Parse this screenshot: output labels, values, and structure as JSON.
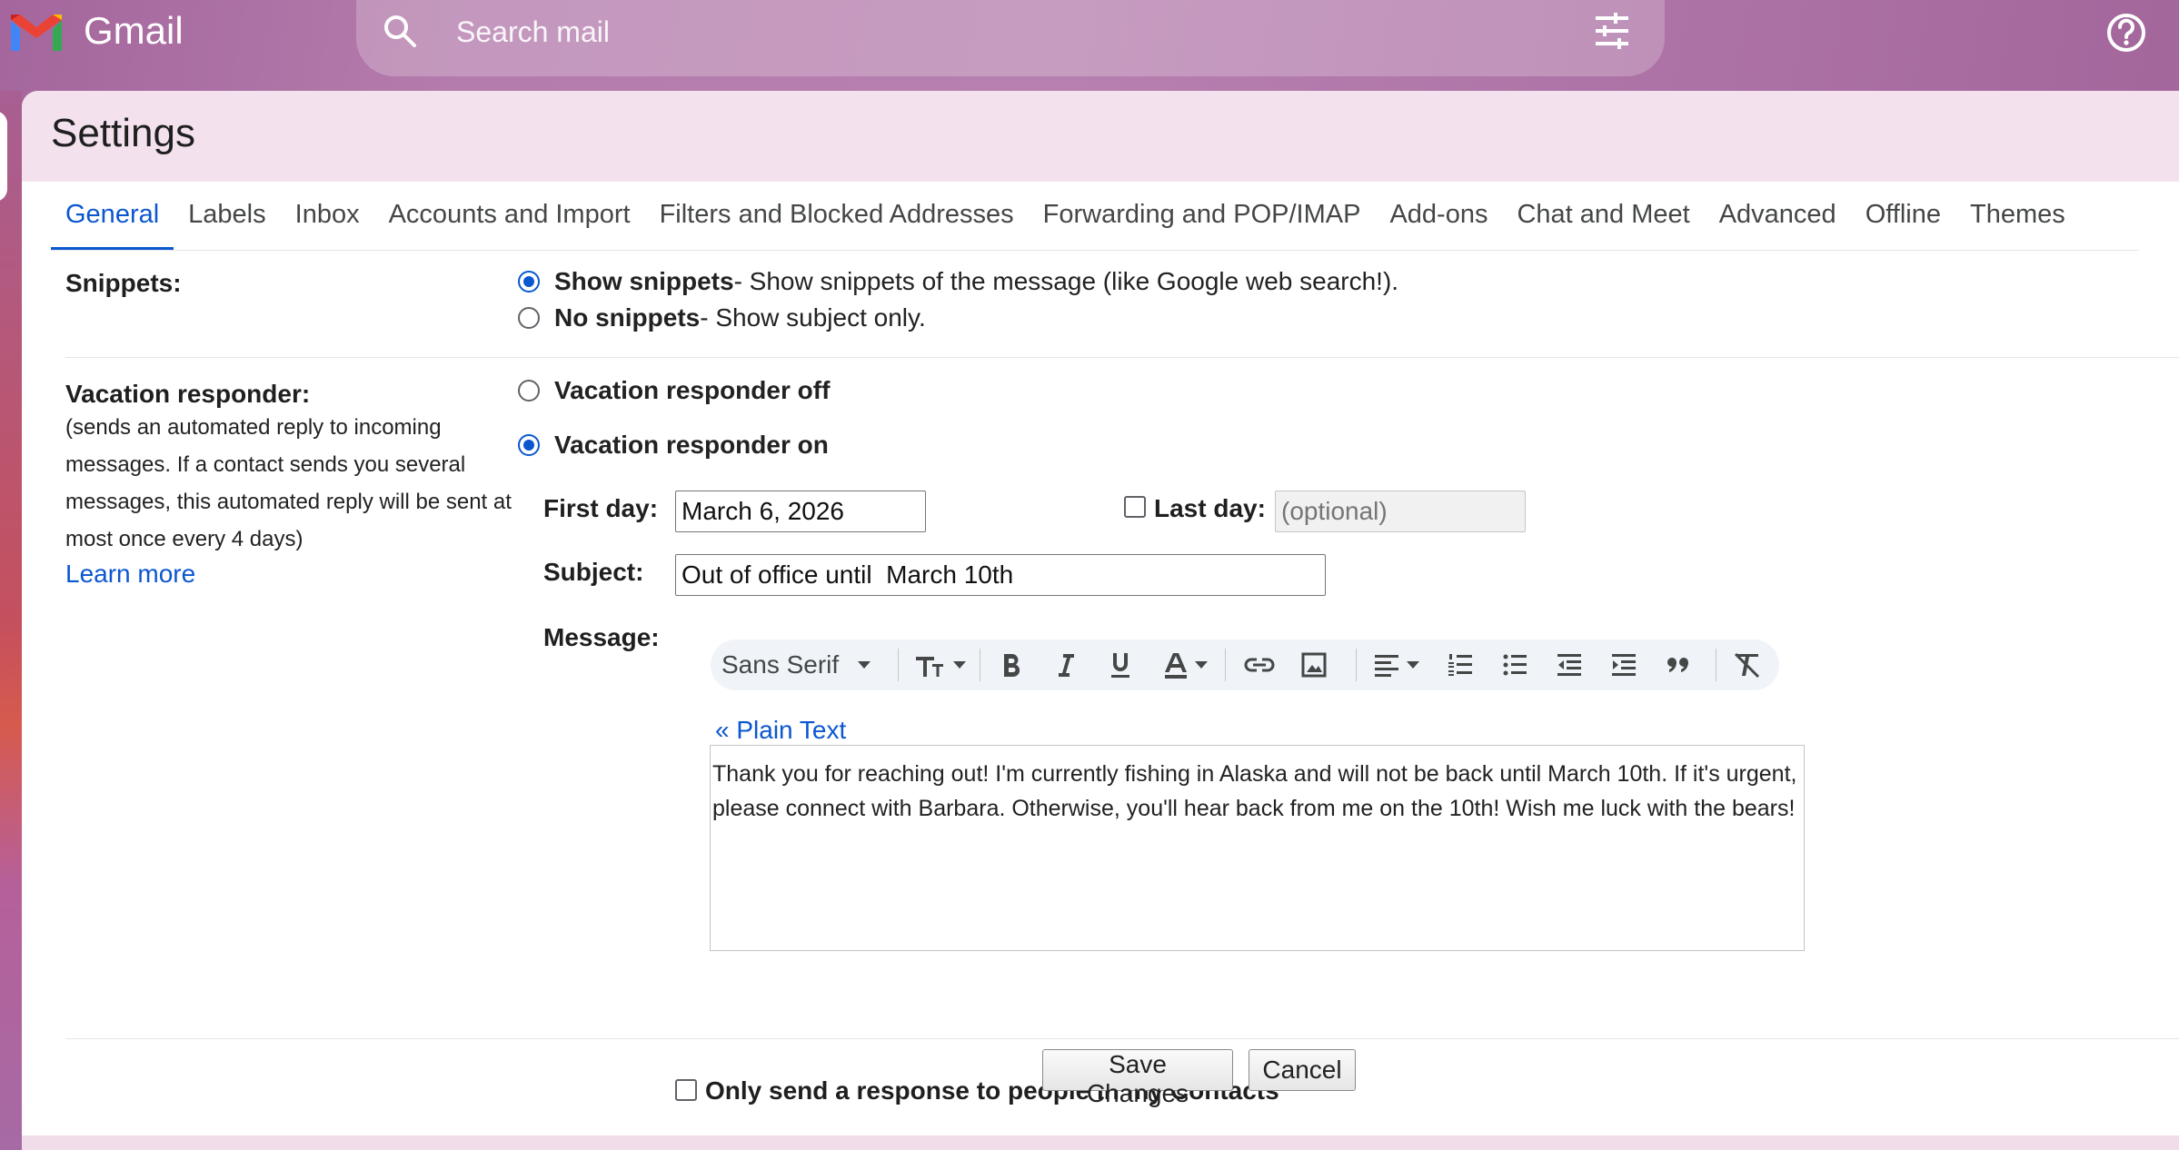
{
  "app": {
    "name": "Gmail"
  },
  "search": {
    "placeholder": "Search mail"
  },
  "settings": {
    "title": "Settings",
    "tabs": [
      {
        "label": "General",
        "active": true
      },
      {
        "label": "Labels"
      },
      {
        "label": "Inbox"
      },
      {
        "label": "Accounts and Import"
      },
      {
        "label": "Filters and Blocked Addresses"
      },
      {
        "label": "Forwarding and POP/IMAP"
      },
      {
        "label": "Add-ons"
      },
      {
        "label": "Chat and Meet"
      },
      {
        "label": "Advanced"
      },
      {
        "label": "Offline"
      },
      {
        "label": "Themes"
      }
    ]
  },
  "snippets": {
    "label": "Snippets:",
    "options": [
      {
        "title": "Show snippets",
        "desc": " - Show snippets of the message (like Google web search!).",
        "selected": true
      },
      {
        "title": "No snippets",
        "desc": " - Show subject only.",
        "selected": false
      }
    ]
  },
  "vacation": {
    "label": "Vacation responder:",
    "description": "(sends an automated reply to incoming messages. If a contact sends you several messages, this automated reply will be sent at most once every 4 days)",
    "learn_more": "Learn more",
    "off_label": "Vacation responder off",
    "on_label": "Vacation responder on",
    "selected": "on",
    "first_day_label": "First day:",
    "first_day_value": "March 6, 2026",
    "last_day_label": "Last day:",
    "last_day_placeholder": "(optional)",
    "last_day_checked": false,
    "subject_label": "Subject:",
    "subject_value": "Out of office until  March 10th",
    "message_label": "Message:",
    "font_name": "Sans Serif",
    "plain_text_link": "« Plain Text",
    "message_body": "Thank you for reaching out! I'm currently fishing in Alaska and will not be back until March 10th. If it's urgent, please connect with Barbara. Otherwise, you'll hear back from me on the 10th! Wish me luck with the bears!",
    "contacts_only_label": "Only send a response to people in my Contacts",
    "contacts_only_checked": false
  },
  "buttons": {
    "save": "Save Changes",
    "cancel": "Cancel"
  },
  "colors": {
    "accent": "#0b57d0",
    "header_bg": "#f3e2ee",
    "toolbar_bg": "#f0f4f9"
  },
  "icons": {
    "logo": "gmail-logo",
    "search": "search-icon",
    "search_options": "tune-icon",
    "help": "help-icon"
  }
}
